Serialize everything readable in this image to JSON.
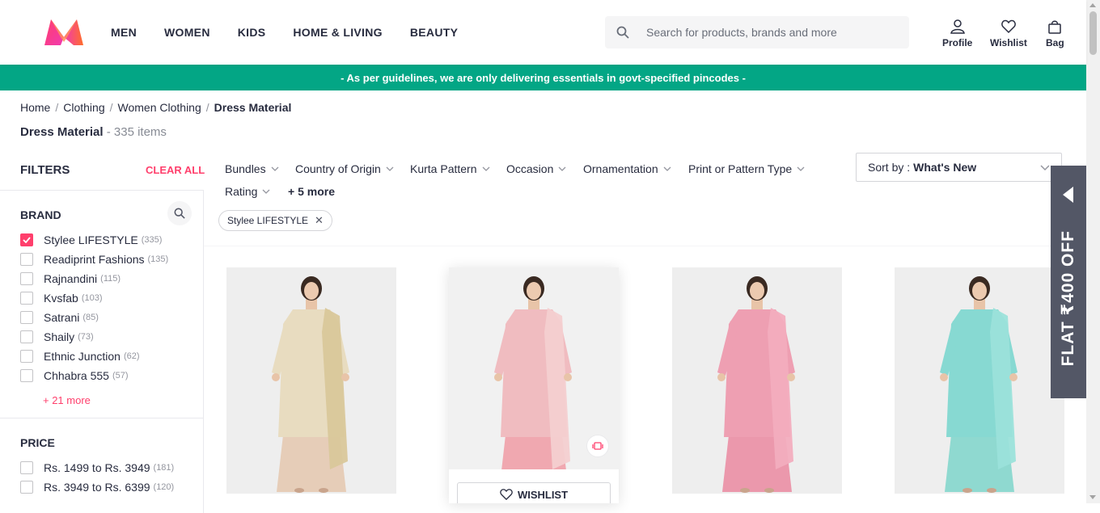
{
  "header": {
    "nav": [
      "MEN",
      "WOMEN",
      "KIDS",
      "HOME & LIVING",
      "BEAUTY"
    ],
    "search_placeholder": "Search for products, brands and more",
    "profile": "Profile",
    "wishlist": "Wishlist",
    "bag": "Bag"
  },
  "banner": "- As per guidelines, we are only delivering essentials in govt-specified pincodes -",
  "breadcrumb": [
    "Home",
    "Clothing",
    "Women Clothing",
    "Dress Material"
  ],
  "title": {
    "name": "Dress Material",
    "count": "- 335 items"
  },
  "filters": {
    "heading": "FILTERS",
    "clear_all": "CLEAR ALL",
    "brand": {
      "title": "BRAND",
      "options": [
        {
          "label": "Stylee LIFESTYLE",
          "count": "(335)",
          "checked": true
        },
        {
          "label": "Readiprint Fashions",
          "count": "(135)",
          "checked": false
        },
        {
          "label": "Rajnandini",
          "count": "(115)",
          "checked": false
        },
        {
          "label": "Kvsfab",
          "count": "(103)",
          "checked": false
        },
        {
          "label": "Satrani",
          "count": "(85)",
          "checked": false
        },
        {
          "label": "Shaily",
          "count": "(73)",
          "checked": false
        },
        {
          "label": "Ethnic Junction",
          "count": "(62)",
          "checked": false
        },
        {
          "label": "Chhabra 555",
          "count": "(57)",
          "checked": false
        }
      ],
      "more": "+ 21 more"
    },
    "price": {
      "title": "PRICE",
      "options": [
        {
          "label": "Rs. 1499 to Rs. 3949",
          "count": "(181)",
          "checked": false
        },
        {
          "label": "Rs. 3949 to Rs. 6399",
          "count": "(120)",
          "checked": false
        }
      ]
    }
  },
  "filter_bar": {
    "items": [
      "Bundles",
      "Country of Origin",
      "Kurta Pattern",
      "Occasion",
      "Ornamentation",
      "Print or Pattern Type",
      "Rating"
    ],
    "more": "+ 5 more",
    "applied": "Stylee LIFESTYLE"
  },
  "sort": {
    "label": "Sort by :",
    "value": "What's New"
  },
  "products": [
    {
      "dress": "#e8dcc0",
      "dupatta": "#d9c79a",
      "pants": "#e6cdb8",
      "bg": "#eeeeee"
    },
    {
      "dress": "#f0bcc0",
      "dupatta": "#f3cfd0",
      "pants": "#f0a8b0",
      "bg": "#f1f1f1"
    },
    {
      "dress": "#ee9fb2",
      "dupatta": "#f2adbe",
      "pants": "#eb98ac",
      "bg": "#eeeeee"
    },
    {
      "dress": "#87d9d2",
      "dupatta": "#9be2da",
      "pants": "#8fd9d0",
      "bg": "#eeeeee"
    }
  ],
  "card_wishlist": "WISHLIST",
  "offer": "FLAT ₹400 OFF",
  "colors": {
    "accent": "#ff3f6c",
    "banner": "#03a685",
    "offer_bg": "#535766"
  }
}
